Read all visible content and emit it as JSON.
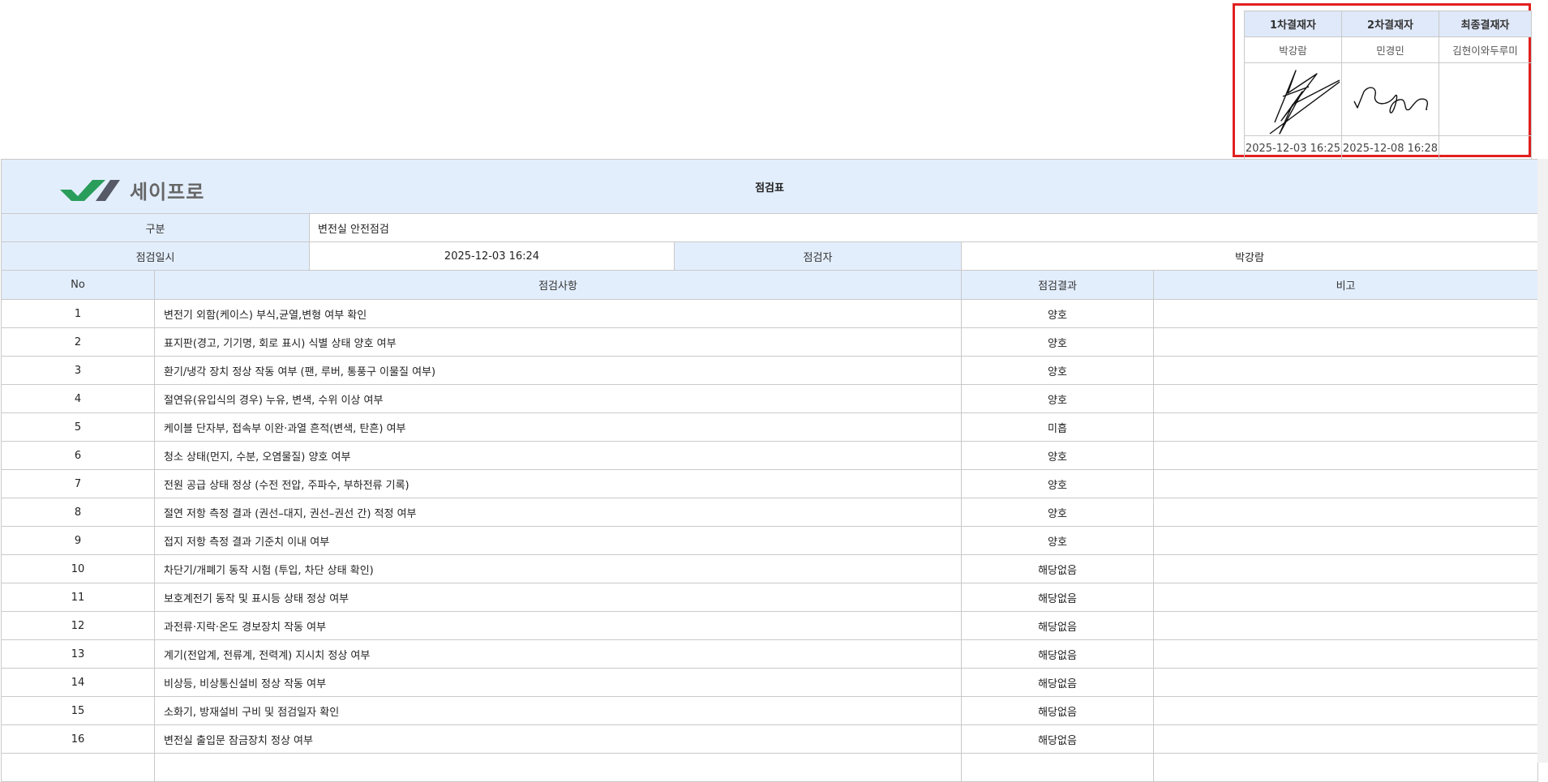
{
  "approval": {
    "headers": [
      "1차결재자",
      "2차결재자",
      "최종결재자"
    ],
    "names": [
      "박강람",
      "민경민",
      "김현이와두루미"
    ],
    "dates": [
      "2025-12-03 16:25",
      "2025-12-08 16:28",
      ""
    ]
  },
  "form": {
    "logo_text": "세이프로",
    "title": "점검표",
    "category_label": "구분",
    "category_value": "변전실 안전점검",
    "date_label": "점검일시",
    "date_value": "2025-12-03 16:24",
    "inspector_label": "점검자",
    "inspector_value": "박강람",
    "columns": [
      "No",
      "점검사항",
      "점검결과",
      "비고"
    ],
    "rows": [
      {
        "no": "1",
        "item": "변전기 외함(케이스) 부식,균열,변형 여부 확인",
        "result": "양호",
        "note": ""
      },
      {
        "no": "2",
        "item": "표지판(경고, 기기명, 회로 표시) 식별 상태 양호 여부",
        "result": "양호",
        "note": ""
      },
      {
        "no": "3",
        "item": "환기/냉각 장치 정상 작동 여부 (팬, 루버, 통풍구 이물질 여부)",
        "result": "양호",
        "note": ""
      },
      {
        "no": "4",
        "item": "절연유(유입식의 경우) 누유, 변색, 수위 이상 여부",
        "result": "양호",
        "note": ""
      },
      {
        "no": "5",
        "item": "케이블 단자부, 접속부 이완·과열 흔적(변색, 탄흔) 여부",
        "result": "미흡",
        "note": ""
      },
      {
        "no": "6",
        "item": "청소 상태(먼지, 수분, 오염물질) 양호 여부",
        "result": "양호",
        "note": ""
      },
      {
        "no": "7",
        "item": "전원 공급 상태 정상 (수전 전압, 주파수, 부하전류 기록)",
        "result": "양호",
        "note": ""
      },
      {
        "no": "8",
        "item": "절연 저항 측정 결과 (권선–대지, 권선–권선 간) 적정 여부",
        "result": "양호",
        "note": ""
      },
      {
        "no": "9",
        "item": "접지 저항 측정 결과 기준치 이내 여부",
        "result": "양호",
        "note": ""
      },
      {
        "no": "10",
        "item": "차단기/개폐기 동작 시험 (투입, 차단 상태 확인)",
        "result": "해당없음",
        "note": ""
      },
      {
        "no": "11",
        "item": "보호계전기 동작 및 표시등 상태 정상 여부",
        "result": "해당없음",
        "note": ""
      },
      {
        "no": "12",
        "item": "과전류·지락·온도 경보장치 작동 여부",
        "result": "해당없음",
        "note": ""
      },
      {
        "no": "13",
        "item": "계기(전압계, 전류계, 전력계) 지시치 정상 여부",
        "result": "해당없음",
        "note": ""
      },
      {
        "no": "14",
        "item": "비상등, 비상통신설비 정상 작동 여부",
        "result": "해당없음",
        "note": ""
      },
      {
        "no": "15",
        "item": "소화기, 방재설비 구비 및 점검일자 확인",
        "result": "해당없음",
        "note": ""
      },
      {
        "no": "16",
        "item": "변전실 출입문 잠금장치 정상 여부",
        "result": "해당없음",
        "note": ""
      },
      {
        "no": "",
        "item": "",
        "result": "",
        "note": ""
      }
    ]
  }
}
